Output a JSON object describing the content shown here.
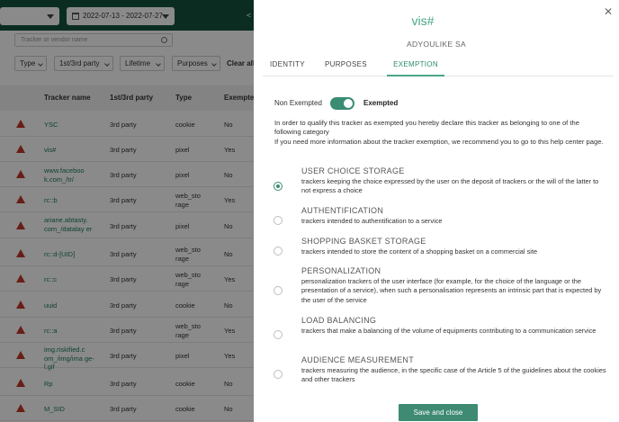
{
  "background": {
    "date_range": "2022-07-13 - 2022-07-27",
    "search_placeholder": "Tracker or vendor name",
    "filters": [
      "Type",
      "1st/3rd party",
      "Lifetime",
      "Purposes"
    ],
    "clear_all": "Clear all",
    "columns": [
      "Tracker name",
      "1st/3rd party",
      "Type",
      "Exempte"
    ],
    "rows": [
      {
        "name": "YSC",
        "party": "3rd party",
        "type": "cookie",
        "exempt": "No"
      },
      {
        "name": "vis#",
        "party": "3rd party",
        "type": "pixel",
        "exempt": "Yes"
      },
      {
        "name": "www.faceboo k.com_/tr/",
        "party": "3rd party",
        "type": "pixel",
        "exempt": "No"
      },
      {
        "name": "rc::b",
        "party": "3rd party",
        "type": "web_sto rage",
        "exempt": "Yes"
      },
      {
        "name": "ariane.abtasty. com_/datalay er",
        "party": "3rd party",
        "type": "pixel",
        "exempt": "No"
      },
      {
        "name": "rc::d-[UID]",
        "party": "3rd party",
        "type": "web_sto rage",
        "exempt": "No"
      },
      {
        "name": "rc::c",
        "party": "3rd party",
        "type": "web_sto rage",
        "exempt": "Yes"
      },
      {
        "name": "uuid",
        "party": "3rd party",
        "type": "cookie",
        "exempt": "No"
      },
      {
        "name": "rc::a",
        "party": "3rd party",
        "type": "web_sto rage",
        "exempt": "Yes"
      },
      {
        "name": "img.riskified.c om_/img/ima ge-l.gif",
        "party": "3rd party",
        "type": "pixel",
        "exempt": "Yes"
      },
      {
        "name": "Rp",
        "party": "3rd party",
        "type": "cookie",
        "exempt": "No"
      },
      {
        "name": "M_SID",
        "party": "3rd party",
        "type": "cookie",
        "exempt": "No"
      }
    ]
  },
  "panel": {
    "title": "vis#",
    "vendor": "ADYOULIKE SA",
    "tabs": [
      "IDENTITY",
      "PURPOSES",
      "EXEMPTION"
    ],
    "active_tab": "EXEMPTION",
    "toggle": {
      "off_label": "Non Exempted",
      "on_label": "Exempted",
      "state": "Exempted"
    },
    "intro_1": "In order to qualify this tracker as exempted you hereby declare this tracker as belonging to one of the following category",
    "intro_2": "If you need more information about the tracker exemption, we recommend you to go to this help center page.",
    "options": [
      {
        "title": "USER CHOICE STORAGE",
        "desc": "trackers keeping the choice expressed by the user on the deposit of trackers or the will of the latter to not express a choice",
        "selected": true
      },
      {
        "title": "AUTHENTIFICATION",
        "desc": "trackers intended to authentification to a service",
        "selected": false
      },
      {
        "title": "SHOPPING BASKET STORAGE",
        "desc": "trackers intended to store the content of a shopping basket on a commercial site",
        "selected": false
      },
      {
        "title": "PERSONALIZATION",
        "desc": "personalization trackers of the user interface (for example, for the choice of the language or the presentation of a service), when such a personalisation represents an intrinsic part that is expected by the user of the service",
        "selected": false
      },
      {
        "title": "LOAD BALANCING",
        "desc": "trackers that make a balancing of the volume of equipments contributing to a communication service",
        "selected": false
      },
      {
        "title": "AUDIENCE MEASUREMENT",
        "desc": "trackers measuring the audience, in the specific case of the Article 5 of the guidelines about the cookies and other trackers",
        "selected": false
      }
    ],
    "save_label": "Save and close"
  },
  "colors": {
    "accent": "#4aa58a",
    "button": "#3e8a72",
    "header_dark": "#16533d",
    "warning": "#c0392b"
  }
}
